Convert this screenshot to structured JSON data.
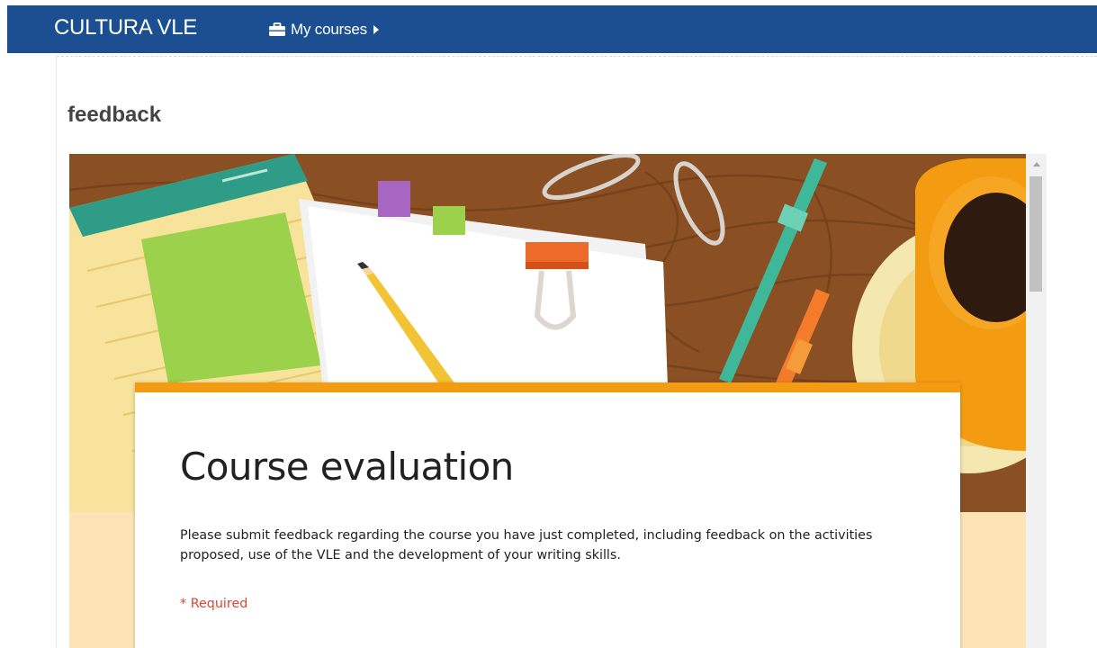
{
  "navbar": {
    "brand": "CULTURA VLE",
    "courses_label": "My courses",
    "courses_icon": "briefcase-icon",
    "bg_color": "#1b4f91"
  },
  "page": {
    "title": "feedback"
  },
  "form": {
    "title": "Course evaluation",
    "description": "Please submit feedback regarding the course you have just completed, including feedback on the activities proposed, use of the VLE and the development of your writing skills.",
    "required_note": "* Required",
    "accent_color": "#f39c12",
    "background_color": "#fce4b6"
  }
}
